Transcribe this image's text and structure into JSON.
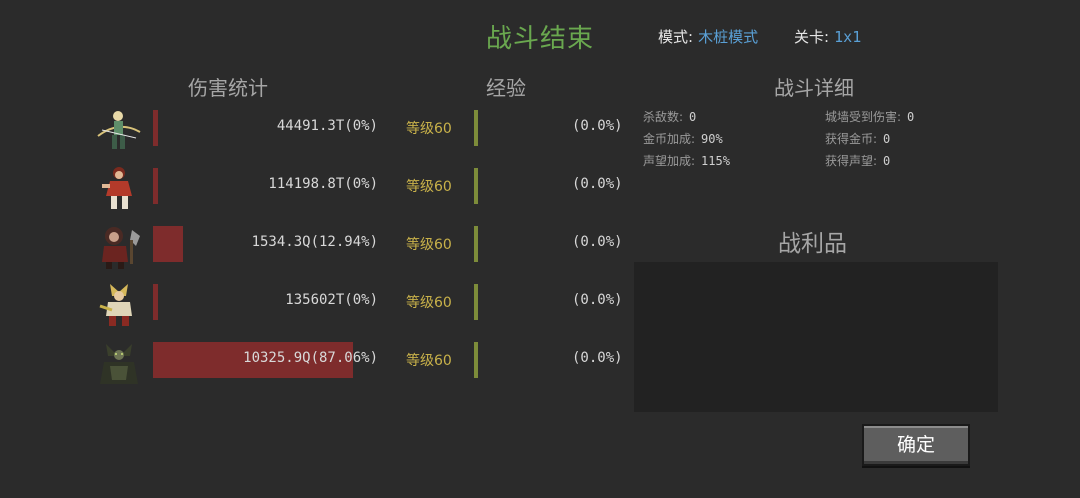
{
  "header": {
    "title": "战斗结束",
    "mode_label": "模式:",
    "mode_value": "木桩模式",
    "stage_label": "关卡:",
    "stage_value": "1x1"
  },
  "sections": {
    "damage": "伤害统计",
    "experience": "经验",
    "details": "战斗详细",
    "loot": "战利品"
  },
  "heroes": [
    {
      "damage": "44491.3T(0%)",
      "damage_share": 0.0,
      "level": "等级60",
      "exp": "(0.0%)",
      "exp_share": 0.0
    },
    {
      "damage": "114198.8T(0%)",
      "damage_share": 0.0,
      "level": "等级60",
      "exp": "(0.0%)",
      "exp_share": 0.0
    },
    {
      "damage": "1534.3Q(12.94%)",
      "damage_share": 0.1294,
      "level": "等级60",
      "exp": "(0.0%)",
      "exp_share": 0.0
    },
    {
      "damage": "135602T(0%)",
      "damage_share": 0.0,
      "level": "等级60",
      "exp": "(0.0%)",
      "exp_share": 0.0
    },
    {
      "damage": "10325.9Q(87.06%)",
      "damage_share": 0.8706,
      "level": "等级60",
      "exp": "(0.0%)",
      "exp_share": 0.0
    }
  ],
  "details": {
    "kills_label": "杀敌数:",
    "kills": "0",
    "wall_damage_label": "城墙受到伤害:",
    "wall_damage": "0",
    "gold_bonus_label": "金币加成:",
    "gold_bonus": "90%",
    "gold_gained_label": "获得金币:",
    "gold_gained": "0",
    "fame_bonus_label": "声望加成:",
    "fame_bonus": "115%",
    "fame_gained_label": "获得声望:",
    "fame_gained": "0"
  },
  "confirm_label": "确定",
  "colors": {
    "title": "#6aa84f",
    "value_blue": "#5aa0d6",
    "damage_bar": "#7e2c2c",
    "level_text": "#c9b24a",
    "exp_bar": "#7d8c3a"
  },
  "icons": [
    "hero-archer-icon",
    "hero-fighter-icon",
    "hero-beast-warrior-icon",
    "hero-paladin-icon",
    "hero-dark-shaman-icon"
  ]
}
